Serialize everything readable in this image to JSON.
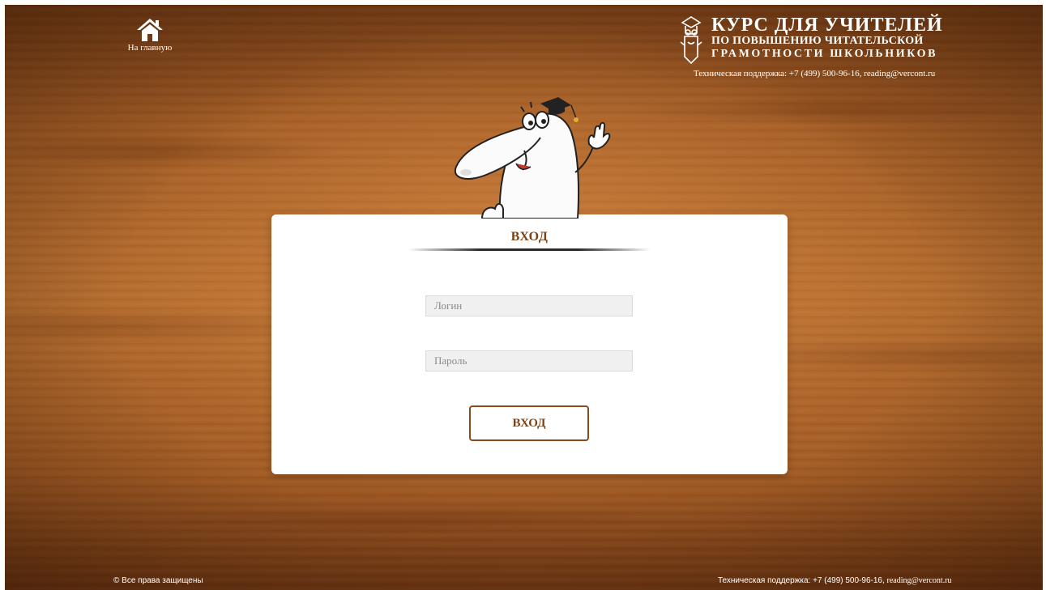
{
  "header": {
    "home_label": "На главную",
    "brand": {
      "title": "КУРС ДЛЯ УЧИТЕЛЕЙ",
      "line2": "ПО ПОВЫШЕНИЮ ЧИТАТЕЛЬСКОЙ",
      "line3": "ГРАМОТНОСТИ ШКОЛЬНИКОВ"
    },
    "support": "Техническая поддержка: +7 (499) 500-96-16, reading@vercont.ru"
  },
  "login_form": {
    "title": "ВХОД",
    "login_placeholder": "Логин",
    "password_placeholder": "Пароль",
    "submit_label": "ВХОД"
  },
  "footer": {
    "copyright": "© Все права защищены",
    "support_prefix": "Техническая поддержка: +7 (499) 500-96-16, ",
    "support_email": "reading@vercont.ru"
  },
  "icons": {
    "home": "home-icon",
    "logo": "pencil-mascot-logo",
    "mascot": "mascot-illustration"
  },
  "colors": {
    "accent": "#7a4215",
    "button_border": "#8a4a1e",
    "field_bg": "#f0f0f0",
    "wood": "#b06a2d"
  }
}
